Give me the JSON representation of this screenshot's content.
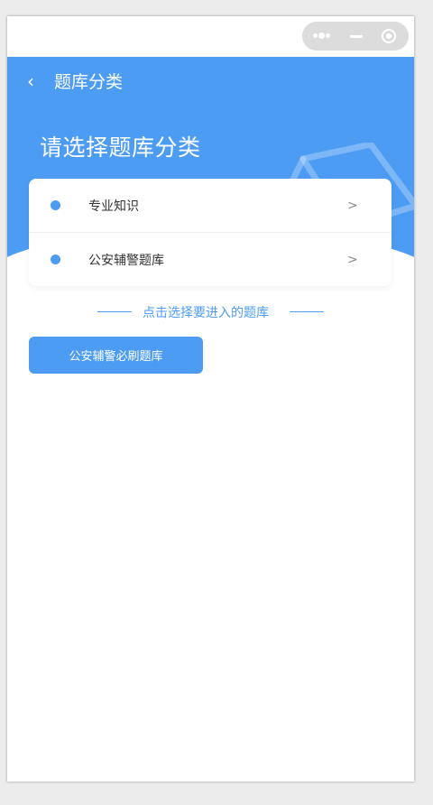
{
  "nav": {
    "title": "题库分类",
    "back_icon": "chevron-left-icon"
  },
  "capsule": {
    "more_icon": "more-dots-icon",
    "minimize_icon": "minus-icon",
    "close_icon": "target-circle-icon"
  },
  "hero": {
    "heading": "请选择题库分类",
    "decoration_icon": "graduation-cap-icon"
  },
  "categories": [
    {
      "label": "专业知识",
      "chevron": ">"
    },
    {
      "label": "公安辅警题库",
      "chevron": ">"
    }
  ],
  "hint": {
    "text": "点击选择要进入的题库"
  },
  "primary_button": {
    "label": "公安辅警必刷题库"
  },
  "colors": {
    "accent": "#4d9cf4",
    "background": "#ffffff",
    "page_bg": "#ececec"
  }
}
